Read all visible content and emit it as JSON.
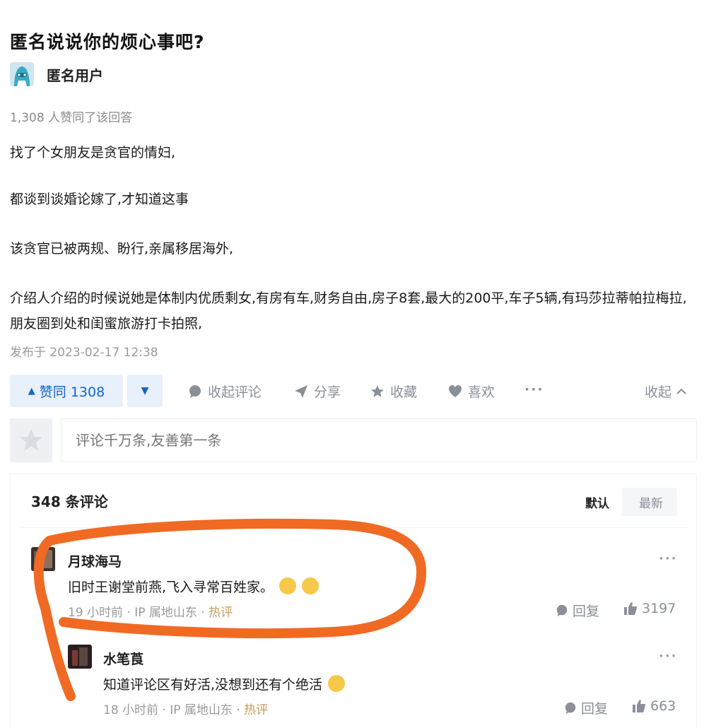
{
  "question": {
    "title": "匿名说说你的烦心事吧?"
  },
  "author": {
    "name": "匿名用户",
    "avatar_icon": "anonymous-avatar-icon"
  },
  "answer": {
    "upvote_info": "1,308 人赞同了该回答",
    "paragraphs": [
      "找了个女朋友是贪官的情妇,",
      "都谈到谈婚论嫁了,才知道这事",
      "该贪官已被两规、盼行,亲属移居海外,",
      "介绍人介绍的时候说她是体制内优质剩女,有房有车,财务自由,房子8套,最大的200平,车子5辆,有玛莎拉蒂帕拉梅拉,朋友圈到处和闺蜜旅游打卡拍照,"
    ],
    "published": "发布于 2023-02-17 12:38"
  },
  "actions": {
    "upvote_label": "赞同 1308",
    "upvote_icon": "triangle-up-icon",
    "downvote_icon": "triangle-down-icon",
    "comment": "收起评论",
    "share": "分享",
    "favorite": "收藏",
    "like": "喜欢",
    "more": "···",
    "collapse": "收起"
  },
  "comment_input": {
    "placeholder": "评论千万条,友善第一条"
  },
  "comments_header": {
    "count": "348 条评论",
    "sort_default": "默认",
    "sort_new": "最新"
  },
  "comments": [
    {
      "name": "月球海马",
      "text": "旧时王谢堂前燕,飞入寻常百姓家。",
      "emojis": [
        "laugh-emoji",
        "laugh-emoji"
      ],
      "time": "19 小时前",
      "ip": "IP 属地山东",
      "tag": "热评",
      "reply": "回复",
      "likes": "3197",
      "more": "···"
    },
    {
      "name": "水笔莨",
      "text": "知道评论区有好活,没想到还有个绝活",
      "emojis": [
        "rofl-emoji"
      ],
      "time": "18 小时前",
      "ip": "IP 属地山东",
      "tag": "热评",
      "reply": "回复",
      "likes": "663",
      "more": "···"
    }
  ],
  "colors": {
    "accent": "#1266c7",
    "annotation": "#f06a24",
    "hot_tag": "#c89b5a"
  }
}
